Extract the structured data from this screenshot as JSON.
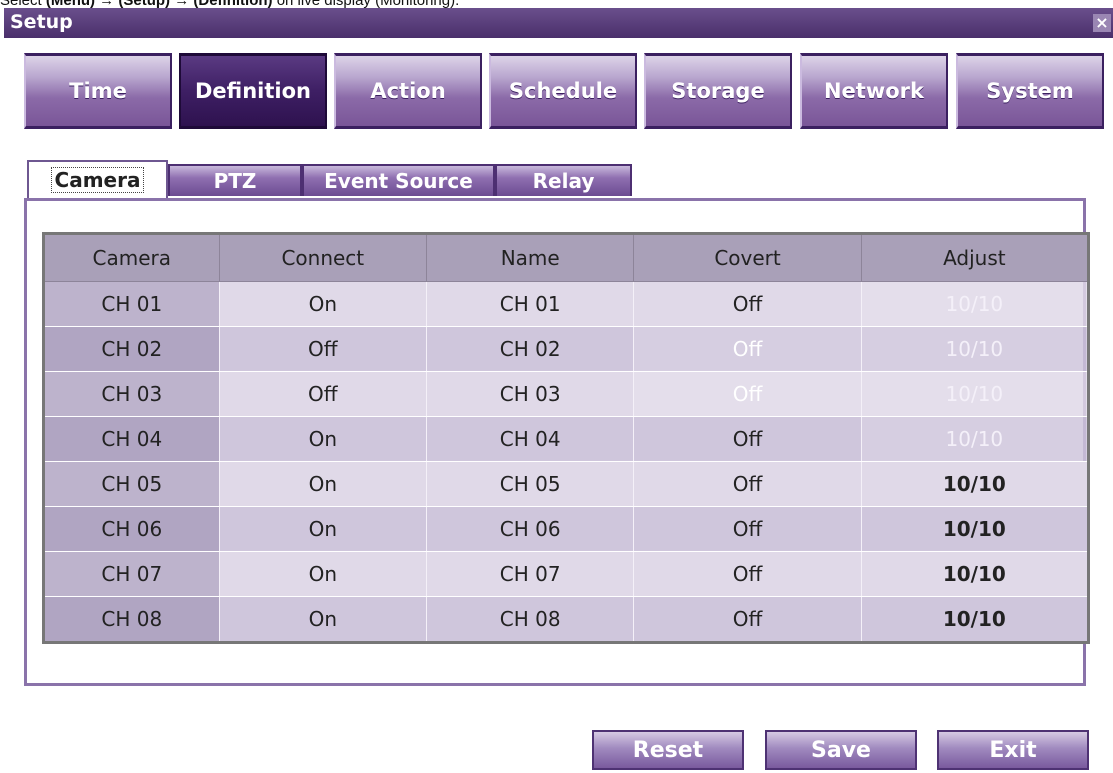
{
  "caption": {
    "prefix": "Select ",
    "menu": "(Menu)",
    "arrow1": " → ",
    "setup": "(Setup)",
    "arrow2": " → ",
    "definition": "(Definition)",
    "suffix": " on live display (Monitoring)."
  },
  "window": {
    "title": "Setup",
    "close_label": "×"
  },
  "main_tabs": [
    {
      "label": "Time",
      "active": false
    },
    {
      "label": "Definition",
      "active": true
    },
    {
      "label": "Action",
      "active": false
    },
    {
      "label": "Schedule",
      "active": false
    },
    {
      "label": "Storage",
      "active": false
    },
    {
      "label": "Network",
      "active": false
    },
    {
      "label": "System",
      "active": false
    }
  ],
  "sub_tabs": [
    {
      "label": "Camera",
      "active": true
    },
    {
      "label": "PTZ",
      "active": false
    },
    {
      "label": "Event Source",
      "active": false
    },
    {
      "label": "Relay",
      "active": false
    }
  ],
  "table": {
    "headers": [
      "Camera",
      "Connect",
      "Name",
      "Covert",
      "Adjust"
    ],
    "rows": [
      [
        "CH 01",
        "On",
        "CH 01",
        "Off",
        "10/10"
      ],
      [
        "CH 02",
        "Off",
        "CH 02",
        "Off",
        "10/10"
      ],
      [
        "CH 03",
        "Off",
        "CH 03",
        "Off",
        "10/10"
      ],
      [
        "CH 04",
        "On",
        "CH 04",
        "Off",
        "10/10"
      ],
      [
        "CH 05",
        "On",
        "CH 05",
        "Off",
        "10/10"
      ],
      [
        "CH 06",
        "On",
        "CH 06",
        "Off",
        "10/10"
      ],
      [
        "CH 07",
        "On",
        "CH 07",
        "Off",
        "10/10"
      ],
      [
        "CH 08",
        "On",
        "CH 08",
        "Off",
        "10/10"
      ]
    ],
    "disabled_covert_rows": [
      1,
      2
    ],
    "disabled_adjust_rows": [
      0,
      1,
      2,
      3
    ]
  },
  "buttons": {
    "reset": "Reset",
    "save": "Save",
    "exit": "Exit"
  },
  "colors": {
    "accent": "#4a2f6b",
    "tab_active": "#3e1f64",
    "panel_border": "#8a73aa"
  }
}
